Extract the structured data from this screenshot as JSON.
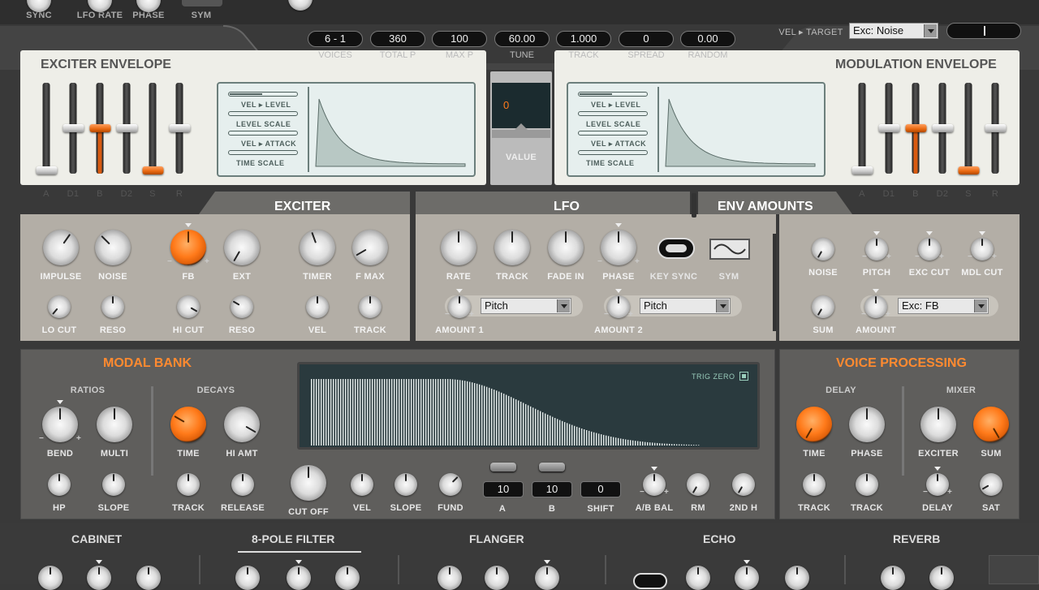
{
  "top_partial": {
    "sync": "SYNC",
    "lfo_rate": "LFO RATE",
    "phase": "PHASE",
    "sym": "SYM"
  },
  "voice_bar": {
    "items": [
      {
        "value": "6 - 1",
        "label": "VOICES"
      },
      {
        "value": "360",
        "label": "TOTAL P"
      },
      {
        "value": "100",
        "label": "MAX P"
      },
      {
        "value": "60.00",
        "label": "TUNE"
      },
      {
        "value": "1.000",
        "label": "TRACK"
      },
      {
        "value": "0",
        "label": "SPREAD"
      },
      {
        "value": "0.00",
        "label": "RANDOM"
      }
    ],
    "vel_target_label": "VEL ▸ TARGET",
    "vel_target_value": "Exc: Noise"
  },
  "exciter_envelope": {
    "title": "EXCITER ENVELOPE",
    "sliders": [
      "A",
      "D1",
      "B",
      "D2",
      "S",
      "R"
    ],
    "lcd_tags": [
      "VEL ▸ LEVEL",
      "LEVEL SCALE",
      "VEL ▸ ATTACK",
      "TIME SCALE"
    ]
  },
  "value_display": {
    "value": "0",
    "label": "VALUE"
  },
  "modulation_envelope": {
    "title": "MODULATION ENVELOPE",
    "sliders": [
      "A",
      "D1",
      "B",
      "D2",
      "S",
      "R"
    ],
    "lcd_tags": [
      "VEL ▸ LEVEL",
      "LEVEL SCALE",
      "VEL ▸ ATTACK",
      "TIME SCALE"
    ]
  },
  "exciter": {
    "title": "EXCITER",
    "knobs": {
      "impulse": "IMPULSE",
      "noise": "NOISE",
      "fb": "FB",
      "ext": "EXT",
      "timer": "TIMER",
      "fmax": "F MAX",
      "locut": "LO CUT",
      "reso1": "RESO",
      "hicut": "HI CUT",
      "reso2": "RESO",
      "vel": "VEL",
      "track": "TRACK"
    }
  },
  "lfo": {
    "title": "LFO",
    "knobs": {
      "rate": "RATE",
      "track": "TRACK",
      "fadein": "FADE IN",
      "phase": "PHASE",
      "keysync": "KEY SYNC",
      "sym": "SYM",
      "amount1": "AMOUNT 1",
      "amount2": "AMOUNT 2"
    },
    "dest1": "Pitch",
    "dest2": "Pitch"
  },
  "env_amounts": {
    "title": "ENV AMOUNTS",
    "knobs": {
      "noise": "NOISE",
      "pitch": "PITCH",
      "exccut": "EXC CUT",
      "mdlcut": "MDL CUT",
      "sum": "SUM",
      "amount": "AMOUNT"
    },
    "dest": "Exc: FB"
  },
  "modal_bank": {
    "title": "MODAL BANK",
    "ratios": "RATIOS",
    "decays": "DECAYS",
    "trig_zero": "TRIG ZERO",
    "knobs": {
      "bend": "BEND",
      "multi": "MULTI",
      "time": "TIME",
      "hiamt": "HI AMT",
      "hp": "HP",
      "slope": "SLOPE",
      "track": "TRACK",
      "release": "RELEASE",
      "cutoff": "CUT OFF",
      "vel": "VEL",
      "slope2": "SLOPE",
      "fund": "FUND",
      "a": "A",
      "b": "B",
      "shift": "SHIFT",
      "abbal": "A/B BAL",
      "rm": "RM",
      "twondh": "2ND H"
    },
    "a_value": "10",
    "b_value": "10",
    "shift_value": "0"
  },
  "voice_processing": {
    "title": "VOICE PROCESSING",
    "delay": "DELAY",
    "mixer": "MIXER",
    "knobs": {
      "time": "TIME",
      "phase": "PHASE",
      "exciter": "EXCITER",
      "sum": "SUM",
      "track1": "TRACK",
      "track2": "TRACK",
      "delay": "DELAY",
      "sat": "SAT"
    }
  },
  "effects": {
    "cabinet": "CABINET",
    "filter": "8-POLE FILTER",
    "flanger": "FLANGER",
    "echo": "ECHO",
    "reverb": "REVERB"
  },
  "colors": {
    "accent": "#ff7a1a",
    "panel_light": "#eeeee8",
    "panel_dark": "#5f5e5c",
    "lcd_bg": "#e6efee"
  }
}
